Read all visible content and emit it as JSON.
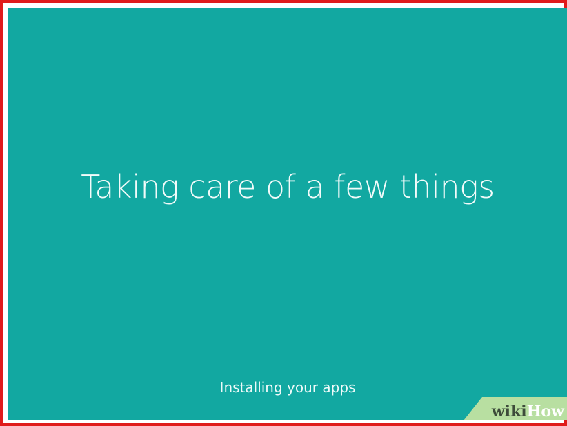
{
  "screen": {
    "background_color": "#12a8a1",
    "headline": "Taking care of a few things",
    "status": "Installing your apps"
  },
  "watermark": {
    "part1": "wiki",
    "part2": "How"
  },
  "colors": {
    "frame": "#e01b1b",
    "text": "#f2fbfa",
    "watermark_bg": "#b8dfa1"
  }
}
